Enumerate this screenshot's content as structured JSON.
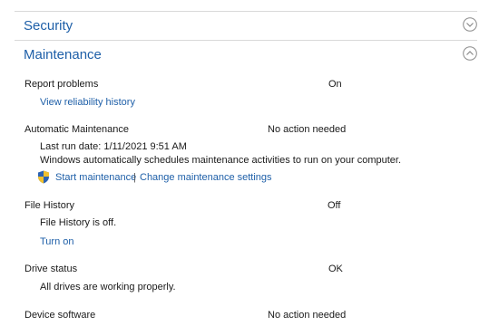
{
  "sections": {
    "security": {
      "title": "Security"
    },
    "maintenance": {
      "title": "Maintenance"
    }
  },
  "rows": {
    "report_problems": {
      "label": "Report problems",
      "status": "On",
      "link": "View reliability history"
    },
    "automatic_maintenance": {
      "label": "Automatic Maintenance",
      "status": "No action needed",
      "last_run": "Last run date: 1/11/2021 9:51 AM",
      "description": "Windows automatically schedules maintenance activities to run on your computer.",
      "start_link": "Start maintenance",
      "separator": "|",
      "settings_link": "Change maintenance settings"
    },
    "file_history": {
      "label": "File History",
      "status": "Off",
      "detail": "File History is off.",
      "link": "Turn on"
    },
    "drive_status": {
      "label": "Drive status",
      "status": "OK",
      "detail": "All drives are working properly."
    },
    "device_software": {
      "label": "Device software",
      "status": "No action needed"
    }
  },
  "icons": {
    "expand": "chevron-down-icon",
    "collapse": "chevron-up-icon",
    "uac": "shield-icon"
  },
  "colors": {
    "accent": "#1e5fa8",
    "divider": "#d9d9d9"
  }
}
